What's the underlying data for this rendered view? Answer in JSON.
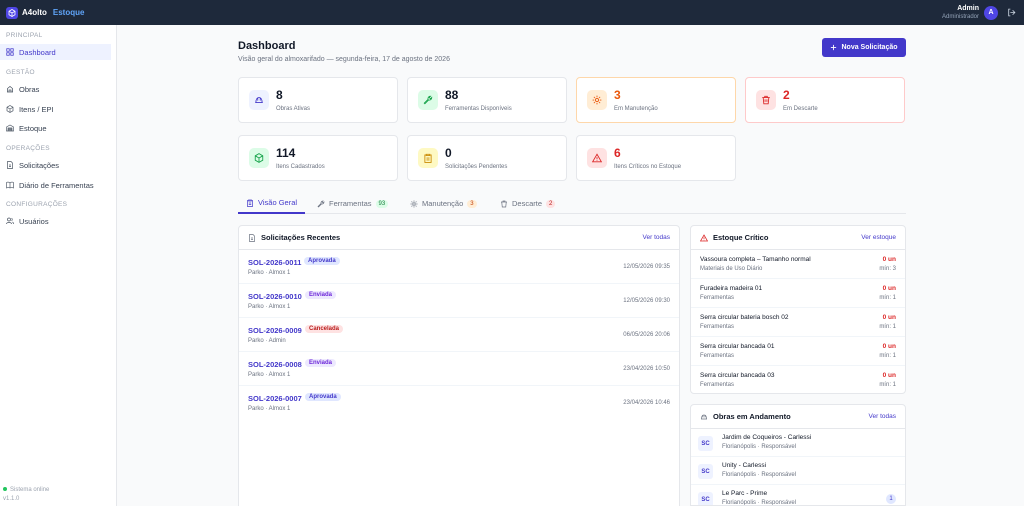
{
  "app": {
    "name": "A4olto",
    "name_accent": "Estoque",
    "version": "v1.1.0",
    "status": "Sistema online"
  },
  "user": {
    "name": "Admin",
    "role": "Administrador",
    "initial": "A"
  },
  "sidebar": {
    "sections": [
      {
        "label": "PRINCIPAL"
      },
      {
        "label": "GESTÃO"
      },
      {
        "label": "OPERAÇÕES"
      },
      {
        "label": "CONFIGURAÇÕES"
      }
    ],
    "items": [
      {
        "label": "Dashboard",
        "icon": "grid-icon"
      },
      {
        "label": "Obras",
        "icon": "building-icon"
      },
      {
        "label": "Itens / EPI",
        "icon": "box-icon"
      },
      {
        "label": "Estoque",
        "icon": "warehouse-icon"
      },
      {
        "label": "Solicitações",
        "icon": "file-icon"
      },
      {
        "label": "Diário de Ferramentas",
        "icon": "book-icon"
      },
      {
        "label": "Usuários",
        "icon": "users-icon"
      }
    ]
  },
  "header": {
    "title": "Dashboard",
    "subtitle": "Visão geral do almoxarifado — segunda-feira, 17 de agosto de 2026",
    "new_button": "Nova Solicitação"
  },
  "stats": [
    {
      "value": "8",
      "label": "Obras Ativas"
    },
    {
      "value": "88",
      "label": "Ferramentas Disponíveis"
    },
    {
      "value": "3",
      "label": "Em Manutenção"
    },
    {
      "value": "2",
      "label": "Em Descarte"
    },
    {
      "value": "114",
      "label": "Itens Cadastrados"
    },
    {
      "value": "0",
      "label": "Solicitações Pendentes"
    },
    {
      "value": "6",
      "label": "Itens Críticos no Estoque"
    }
  ],
  "tabs": [
    {
      "label": "Visão Geral",
      "badge": ""
    },
    {
      "label": "Ferramentas",
      "badge": "93"
    },
    {
      "label": "Manutenção",
      "badge": "3"
    },
    {
      "label": "Descarte",
      "badge": "2"
    }
  ],
  "requests": {
    "title": "Solicitações Recentes",
    "link": "Ver todas",
    "rows": [
      {
        "id": "SOL-2026-0011",
        "status": "Aprovada",
        "sub": "Parko · Almox 1",
        "date": "12/05/2026 09:35"
      },
      {
        "id": "SOL-2026-0010",
        "status": "Enviada",
        "sub": "Parko · Almox 1",
        "date": "12/05/2026 09:30"
      },
      {
        "id": "SOL-2026-0009",
        "status": "Cancelada",
        "sub": "Parko · Admin",
        "date": "06/05/2026 20:06"
      },
      {
        "id": "SOL-2026-0008",
        "status": "Enviada",
        "sub": "Parko · Almox 1",
        "date": "23/04/2026 10:50"
      },
      {
        "id": "SOL-2026-0007",
        "status": "Aprovada",
        "sub": "Parko · Almox 1",
        "date": "23/04/2026 10:46"
      }
    ]
  },
  "critical": {
    "title": "Estoque Crítico",
    "link": "Ver estoque",
    "rows": [
      {
        "name": "Vassoura completa – Tamanho normal",
        "cat": "Materiais de Uso Diário",
        "value": "0 un",
        "min": "mín: 3"
      },
      {
        "name": "Furadeira madeira 01",
        "cat": "Ferramentas",
        "value": "0 un",
        "min": "mín: 1"
      },
      {
        "name": "Serra circular bateria bosch 02",
        "cat": "Ferramentas",
        "value": "0 un",
        "min": "mín: 1"
      },
      {
        "name": "Serra circular bancada 01",
        "cat": "Ferramentas",
        "value": "0 un",
        "min": "mín: 1"
      },
      {
        "name": "Serra circular bancada 03",
        "cat": "Ferramentas",
        "value": "0 un",
        "min": "mín: 1"
      }
    ]
  },
  "works": {
    "title": "Obras em Andamento",
    "link": "Ver todas",
    "rows": [
      {
        "initials": "SC",
        "name": "Jardim de Coqueiros - Carlessi",
        "loc": "Florianópolis · Responsável",
        "count": ""
      },
      {
        "initials": "SC",
        "name": "Unity - Carlessi",
        "loc": "Florianópolis · Responsável",
        "count": ""
      },
      {
        "initials": "SC",
        "name": "Le Parc - Prime",
        "loc": "Florianópolis · Responsável",
        "count": "1"
      }
    ]
  }
}
